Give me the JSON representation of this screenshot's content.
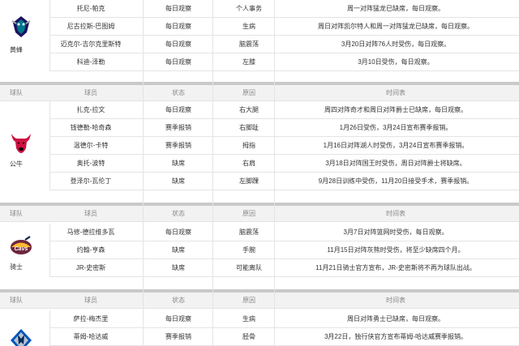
{
  "headers": {
    "team": "球队",
    "player": "球员",
    "status": "状态",
    "reason": "原因",
    "schedule": "时间表"
  },
  "teams": [
    {
      "name": "黄蜂",
      "logo": "hornets-logo",
      "rows": [
        {
          "player": "托尼-帕克",
          "status": "每日观察",
          "reason": "个人事务",
          "schedule": "周一对阵猛龙已缺席，每日观察。"
        },
        {
          "player": "尼古拉斯-巴图姆",
          "status": "每日观察",
          "reason": "生病",
          "schedule": "周日对阵凯尔特人和周一对阵猛龙已缺席，每日观察。"
        },
        {
          "player": "迈克尔-吉尔克里斯特",
          "status": "每日观察",
          "reason": "脑震荡",
          "schedule": "3月20日对阵76人时受伤，每日观察。"
        },
        {
          "player": "科迪-泽勒",
          "status": "每日观察",
          "reason": "左膝",
          "schedule": "3月10日受伤，每日观察。"
        }
      ]
    },
    {
      "name": "公牛",
      "logo": "bulls-logo",
      "rows": [
        {
          "player": "扎克-拉文",
          "status": "每日观察",
          "reason": "右大腿",
          "schedule": "周四对阵奇才和周日对阵爵士已缺席，每日观察。"
        },
        {
          "player": "钱德勒-哈奇森",
          "status": "赛季报销",
          "reason": "右脚趾",
          "schedule": "1月26日受伤，3月24日宣布赛季报销。"
        },
        {
          "player": "温德尔-卡特",
          "status": "赛季报销",
          "reason": "拇指",
          "schedule": "1月16日对阵湖人时受伤，3月24日宣布赛季报销。"
        },
        {
          "player": "奥托-波特",
          "status": "缺席",
          "reason": "右肩",
          "schedule": "3月18日对阵国王时受伤，周日对阵爵士将缺席。"
        },
        {
          "player": "登泽尔-瓦伦丁",
          "status": "缺席",
          "reason": "左脚踝",
          "schedule": "9月28日训练中受伤，11月20日接受手术，赛季报销。"
        }
      ]
    },
    {
      "name": "骑士",
      "logo": "cavaliers-logo",
      "rows": [
        {
          "player": "马修-德拉维多瓦",
          "status": "每日观察",
          "reason": "脑震荡",
          "schedule": "3月7日对阵篮网时受伤，每日观察。"
        },
        {
          "player": "约翰-亨森",
          "status": "缺席",
          "reason": "手腕",
          "schedule": "11月15日对阵灰熊时受伤，将至少缺席四个月。"
        },
        {
          "player": "JR-史密斯",
          "status": "缺席",
          "reason": "可能离队",
          "schedule": "11月21日骑士官方宣布，JR-史密斯将不再为球队出战。"
        }
      ]
    },
    {
      "name": "",
      "logo": "mavericks-logo",
      "rows": [
        {
          "player": "萨拉-梅杰里",
          "status": "每日观察",
          "reason": "生病",
          "schedule": "周日对阵勇士已缺席，每日观察。"
        },
        {
          "player": "蒂姆-哈达威",
          "status": "赛季报销",
          "reason": "胫骨",
          "schedule": "3月22日，独行侠官方宣布蒂姆-哈达威赛季报销。"
        }
      ]
    }
  ]
}
